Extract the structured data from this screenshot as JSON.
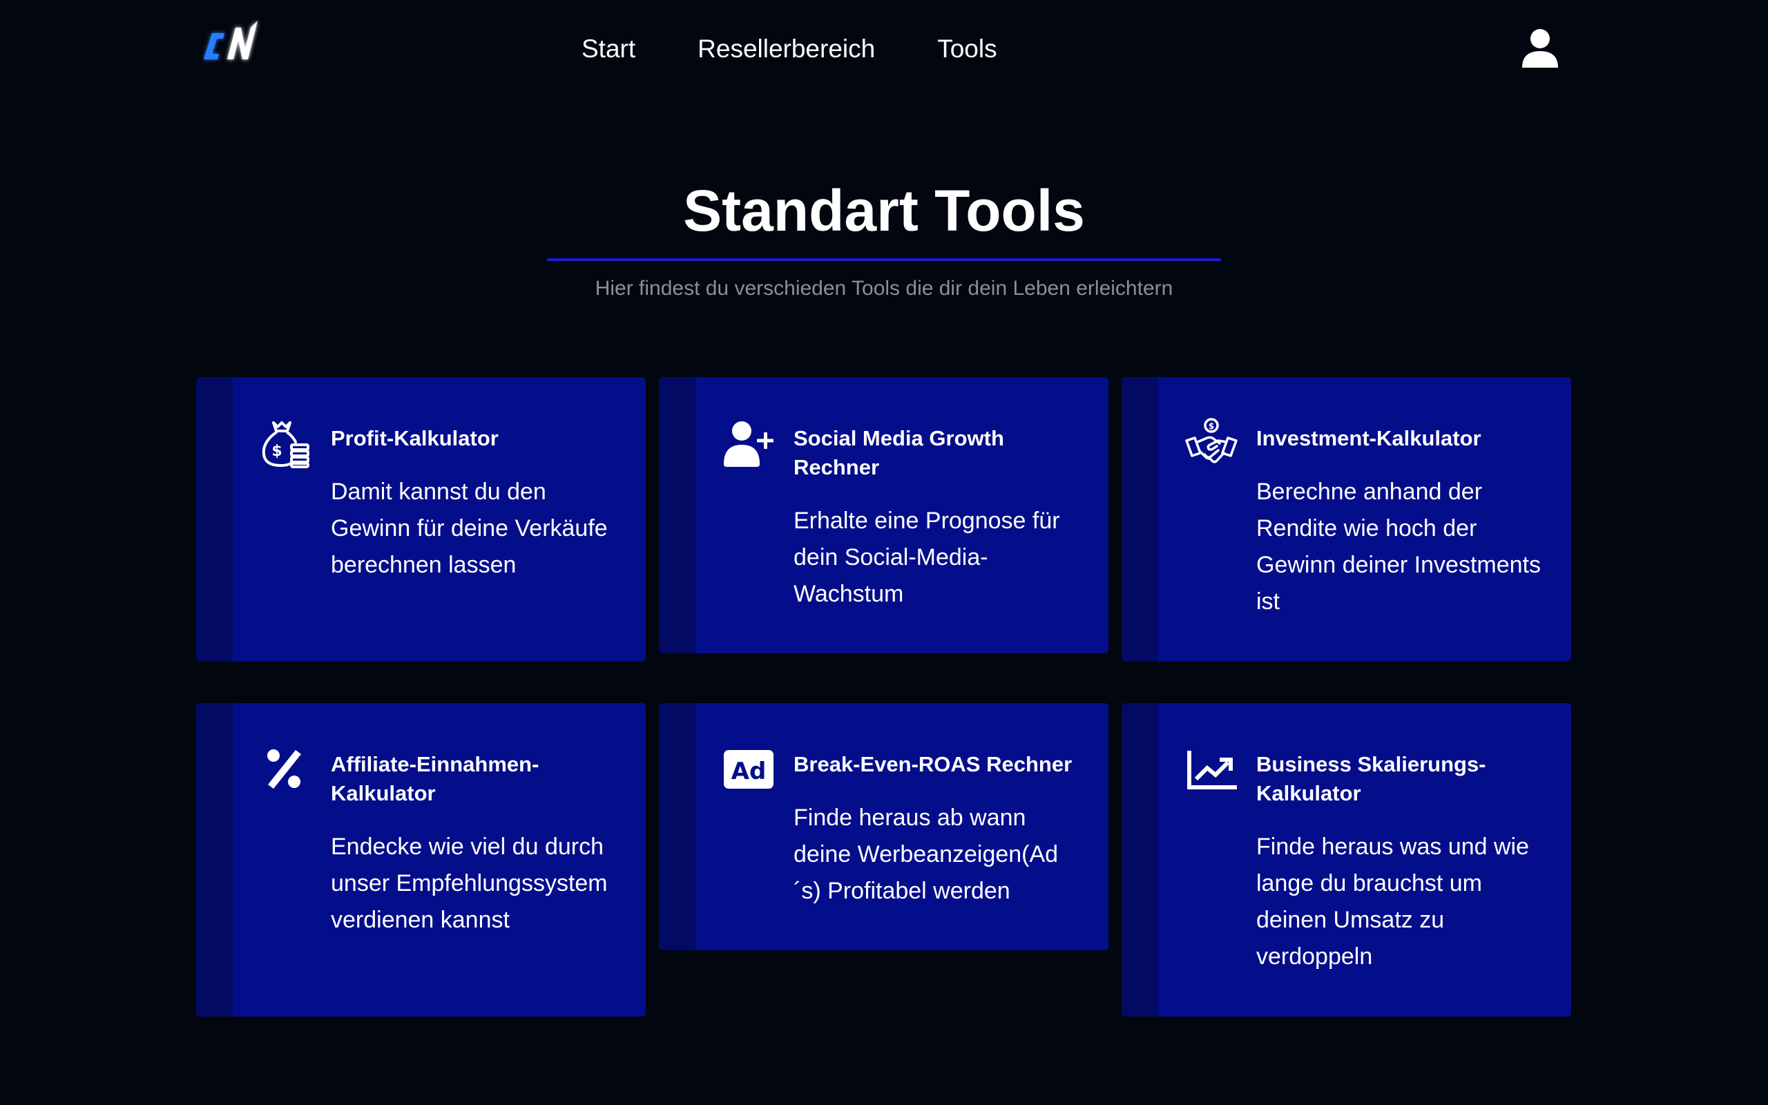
{
  "header": {
    "logo_text": "CN",
    "nav": [
      {
        "label": "Start"
      },
      {
        "label": "Resellerbereich"
      },
      {
        "label": "Tools"
      }
    ]
  },
  "hero": {
    "title": "Standart Tools",
    "subtitle": "Hier findest du verschieden Tools die dir dein Leben erleichtern"
  },
  "cards": [
    {
      "title": "Profit-Kalkulator",
      "description": "Damit kannst du den Gewinn für deine Verkäufe berechnen lassen",
      "icon": "money-bag-icon"
    },
    {
      "title": "Social Media Growth Rechner",
      "description": "Erhalte eine Prognose für dein Social-Media-Wachstum",
      "icon": "user-plus-icon"
    },
    {
      "title": "Investment-Kalkulator",
      "description": "Berechne anhand der Rendite wie hoch der Gewinn deiner Investments ist",
      "icon": "handshake-icon"
    },
    {
      "title": "Affiliate-Einnahmen-Kalkulator",
      "description": "Endecke wie viel du durch unser Empfehlungssystem verdienen kannst",
      "icon": "percent-icon"
    },
    {
      "title": "Break-Even-ROAS Rechner",
      "description": "Finde heraus ab wann deine Werbeanzeigen(Ad´s) Profitabel werden",
      "icon": "ad-icon"
    },
    {
      "title": "Business Skalierungs-Kalkulator",
      "description": "Finde heraus was und wie lange du brauchst um deinen Umsatz zu verdoppeln",
      "icon": "chart-growth-icon"
    }
  ]
}
